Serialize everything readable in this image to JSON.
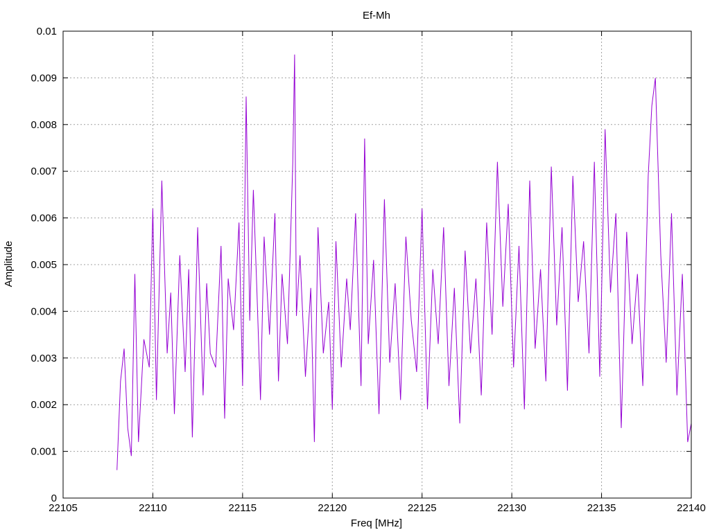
{
  "chart_data": {
    "type": "line",
    "title": "Ef-Mh",
    "xlabel": "Freq [MHz]",
    "ylabel": "Amplitude",
    "xlim": [
      22105,
      22140
    ],
    "ylim": [
      0,
      0.01
    ],
    "xticks": [
      22105,
      22110,
      22115,
      22120,
      22125,
      22130,
      22135,
      22140
    ],
    "xtick_labels": [
      "22105",
      "22110",
      "22115",
      "22120",
      "22125",
      "22130",
      "22135",
      "22140"
    ],
    "yticks": [
      0,
      0.001,
      0.002,
      0.003,
      0.004,
      0.005,
      0.006,
      0.007,
      0.008,
      0.009,
      0.01
    ],
    "ytick_labels": [
      "0",
      "0.001",
      "0.002",
      "0.003",
      "0.004",
      "0.005",
      "0.006",
      "0.007",
      "0.008",
      "0.009",
      "0.01"
    ],
    "grid": true,
    "line_color": "#9400d3",
    "series": [
      {
        "x": [
          22108.0,
          22108.2,
          22108.4,
          22108.6,
          22108.8,
          22109.0,
          22109.2,
          22109.5,
          22109.8,
          22110.0,
          22110.2,
          22110.5,
          22110.8,
          22111.0,
          22111.2,
          22111.5,
          22111.8,
          22112.0,
          22112.2,
          22112.5,
          22112.8,
          22113.0,
          22113.2,
          22113.5,
          22113.8,
          22114.0,
          22114.2,
          22114.5,
          22114.8,
          22115.0,
          22115.2,
          22115.4,
          22115.6,
          22115.8,
          22116.0,
          22116.2,
          22116.5,
          22116.8,
          22117.0,
          22117.2,
          22117.5,
          22117.8,
          22117.9,
          22118.0,
          22118.2,
          22118.5,
          22118.8,
          22119.0,
          22119.2,
          22119.5,
          22119.8,
          22120.0,
          22120.2,
          22120.5,
          22120.8,
          22121.0,
          22121.3,
          22121.6,
          22121.8,
          22122.0,
          22122.3,
          22122.6,
          22122.9,
          22123.2,
          22123.5,
          22123.8,
          22124.1,
          22124.4,
          22124.7,
          22125.0,
          22125.3,
          22125.6,
          22125.9,
          22126.2,
          22126.5,
          22126.8,
          22127.1,
          22127.4,
          22127.7,
          22128.0,
          22128.3,
          22128.6,
          22128.9,
          22129.2,
          22129.5,
          22129.8,
          22130.1,
          22130.4,
          22130.7,
          22131.0,
          22131.3,
          22131.6,
          22131.9,
          22132.2,
          22132.5,
          22132.8,
          22133.1,
          22133.4,
          22133.7,
          22134.0,
          22134.3,
          22134.6,
          22134.9,
          22135.2,
          22135.5,
          22135.8,
          22136.1,
          22136.4,
          22136.7,
          22137.0,
          22137.3,
          22137.6,
          22137.8,
          22138.0,
          22138.3,
          22138.6,
          22138.9,
          22139.2,
          22139.5,
          22139.8,
          22140.0
        ],
        "y": [
          0.0006,
          0.0025,
          0.0032,
          0.0015,
          0.0009,
          0.0048,
          0.0012,
          0.0034,
          0.0028,
          0.0062,
          0.0021,
          0.0068,
          0.0031,
          0.0044,
          0.0018,
          0.0052,
          0.0027,
          0.0049,
          0.0013,
          0.0058,
          0.0022,
          0.0046,
          0.0031,
          0.0028,
          0.0054,
          0.0017,
          0.0047,
          0.0036,
          0.0059,
          0.0024,
          0.0086,
          0.0038,
          0.0066,
          0.0044,
          0.0021,
          0.0056,
          0.0035,
          0.0061,
          0.0025,
          0.0048,
          0.0033,
          0.0072,
          0.0095,
          0.0039,
          0.0052,
          0.0026,
          0.0045,
          0.0012,
          0.0058,
          0.0031,
          0.0042,
          0.0019,
          0.0055,
          0.0028,
          0.0047,
          0.0036,
          0.0061,
          0.0024,
          0.0077,
          0.0033,
          0.0051,
          0.0018,
          0.0064,
          0.0029,
          0.0046,
          0.0021,
          0.0056,
          0.0038,
          0.0027,
          0.0062,
          0.0019,
          0.0049,
          0.0033,
          0.0058,
          0.0024,
          0.0045,
          0.0016,
          0.0053,
          0.0031,
          0.0047,
          0.0022,
          0.0059,
          0.0035,
          0.0072,
          0.0041,
          0.0063,
          0.0028,
          0.0054,
          0.0019,
          0.0068,
          0.0032,
          0.0049,
          0.0025,
          0.0071,
          0.0037,
          0.0058,
          0.0023,
          0.0069,
          0.0042,
          0.0055,
          0.0031,
          0.0072,
          0.0026,
          0.0079,
          0.0044,
          0.0061,
          0.0015,
          0.0057,
          0.0033,
          0.0048,
          0.0024,
          0.0069,
          0.0084,
          0.009,
          0.0052,
          0.0029,
          0.0061,
          0.0022,
          0.0048,
          0.0012,
          0.0016
        ]
      }
    ]
  }
}
